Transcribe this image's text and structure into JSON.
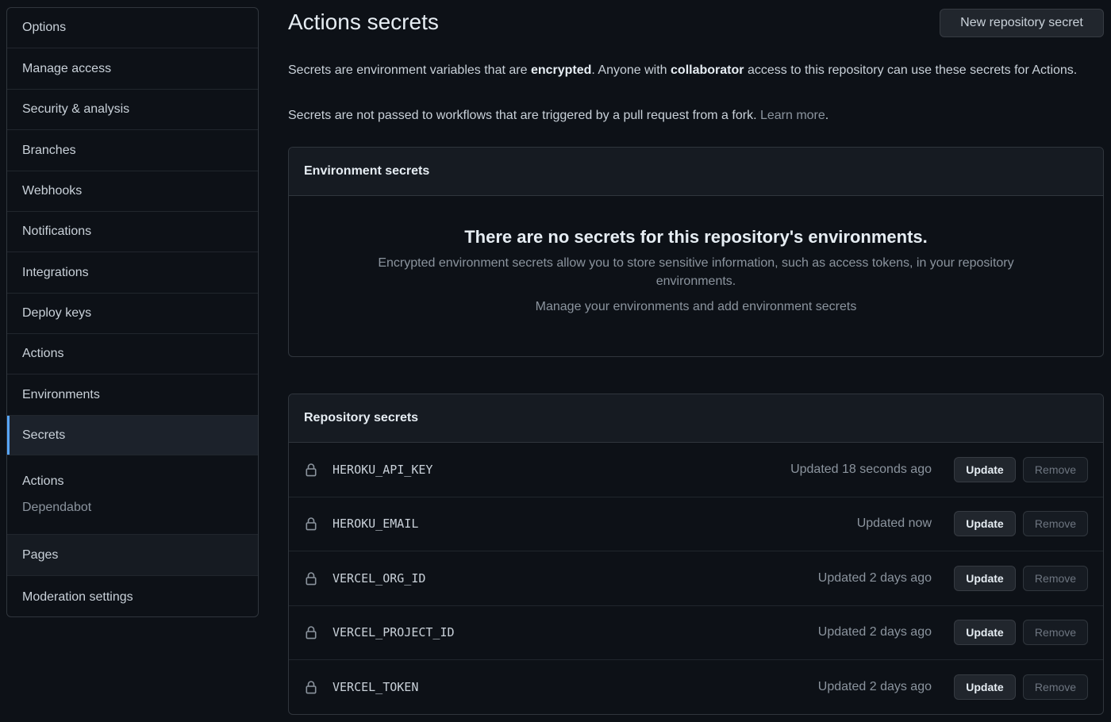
{
  "sidebar": {
    "items": [
      {
        "label": "Options"
      },
      {
        "label": "Manage access"
      },
      {
        "label": "Security & analysis"
      },
      {
        "label": "Branches"
      },
      {
        "label": "Webhooks"
      },
      {
        "label": "Notifications"
      },
      {
        "label": "Integrations"
      },
      {
        "label": "Deploy keys"
      },
      {
        "label": "Actions"
      },
      {
        "label": "Environments"
      },
      {
        "label": "Secrets"
      }
    ],
    "group": {
      "heading": "Actions",
      "sub": "Dependabot"
    },
    "after": [
      {
        "label": "Pages"
      },
      {
        "label": "Moderation settings"
      }
    ]
  },
  "main": {
    "title": "Actions secrets",
    "new_button": "New repository secret",
    "intro": {
      "p1_a": "Secrets are environment variables that are ",
      "p1_b": "encrypted",
      "p1_c": ". Anyone with ",
      "p1_d": "collaborator",
      "p1_e": " access to this repository can use these secrets for Actions.",
      "p2_a": "Secrets are not passed to workflows that are triggered by a pull request from a fork. ",
      "p2_link": "Learn more",
      "p2_end": "."
    },
    "env": {
      "header": "Environment secrets",
      "blank_title": "There are no secrets for this repository's environments.",
      "blank_desc": "Encrypted environment secrets allow you to store sensitive information, such as access tokens, in your repository environments.",
      "blank_link": "Manage your environments and add environment secrets"
    },
    "repo": {
      "header": "Repository secrets",
      "update_label": "Update",
      "remove_label": "Remove",
      "secrets": [
        {
          "name": "HEROKU_API_KEY",
          "updated": "Updated 18 seconds ago"
        },
        {
          "name": "HEROKU_EMAIL",
          "updated": "Updated now"
        },
        {
          "name": "VERCEL_ORG_ID",
          "updated": "Updated 2 days ago"
        },
        {
          "name": "VERCEL_PROJECT_ID",
          "updated": "Updated 2 days ago"
        },
        {
          "name": "VERCEL_TOKEN",
          "updated": "Updated 2 days ago"
        }
      ]
    }
  },
  "colors": {
    "background": "#0d1117",
    "accent": "#58a6ff",
    "border": "#30363d"
  }
}
